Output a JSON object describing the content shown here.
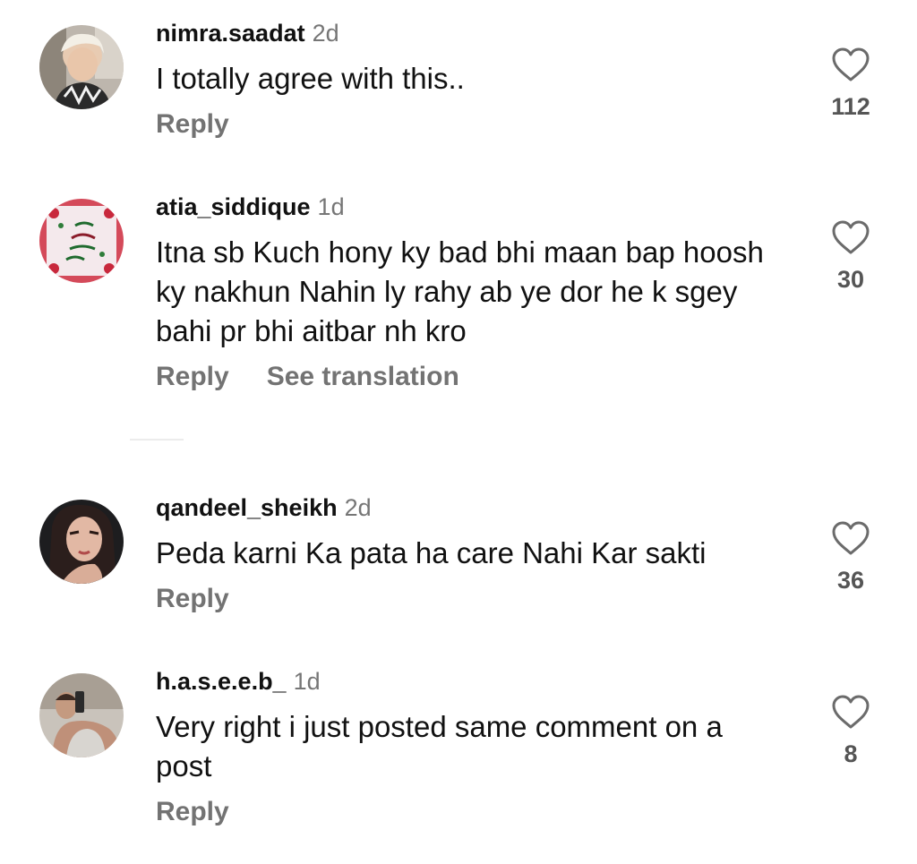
{
  "comments": [
    {
      "username": "nimra.saadat",
      "time": "2d",
      "text": "I totally agree with this..",
      "reply_label": "Reply",
      "likes": "112"
    },
    {
      "username": "atia_siddique",
      "time": "1d",
      "text": "Itna sb Kuch hony ky bad bhi maan bap hoosh ky nakhun Nahin ly rahy ab ye dor he k sgey bahi pr bhi aitbar nh kro",
      "reply_label": "Reply",
      "translation_label": "See translation",
      "likes": "30"
    },
    {
      "username": "qandeel_sheikh",
      "time": "2d",
      "text": "Peda karni Ka pata ha care Nahi Kar sakti",
      "reply_label": "Reply",
      "likes": "36"
    },
    {
      "username": "h.a.s.e.e.b_",
      "time": "1d",
      "text": "Very right i just posted same comment on a post",
      "reply_label": "Reply",
      "likes": "8"
    }
  ],
  "icons": {
    "like": "heart-outline-icon"
  },
  "colors": {
    "text": "#111111",
    "muted": "#737373",
    "background": "#ffffff"
  }
}
